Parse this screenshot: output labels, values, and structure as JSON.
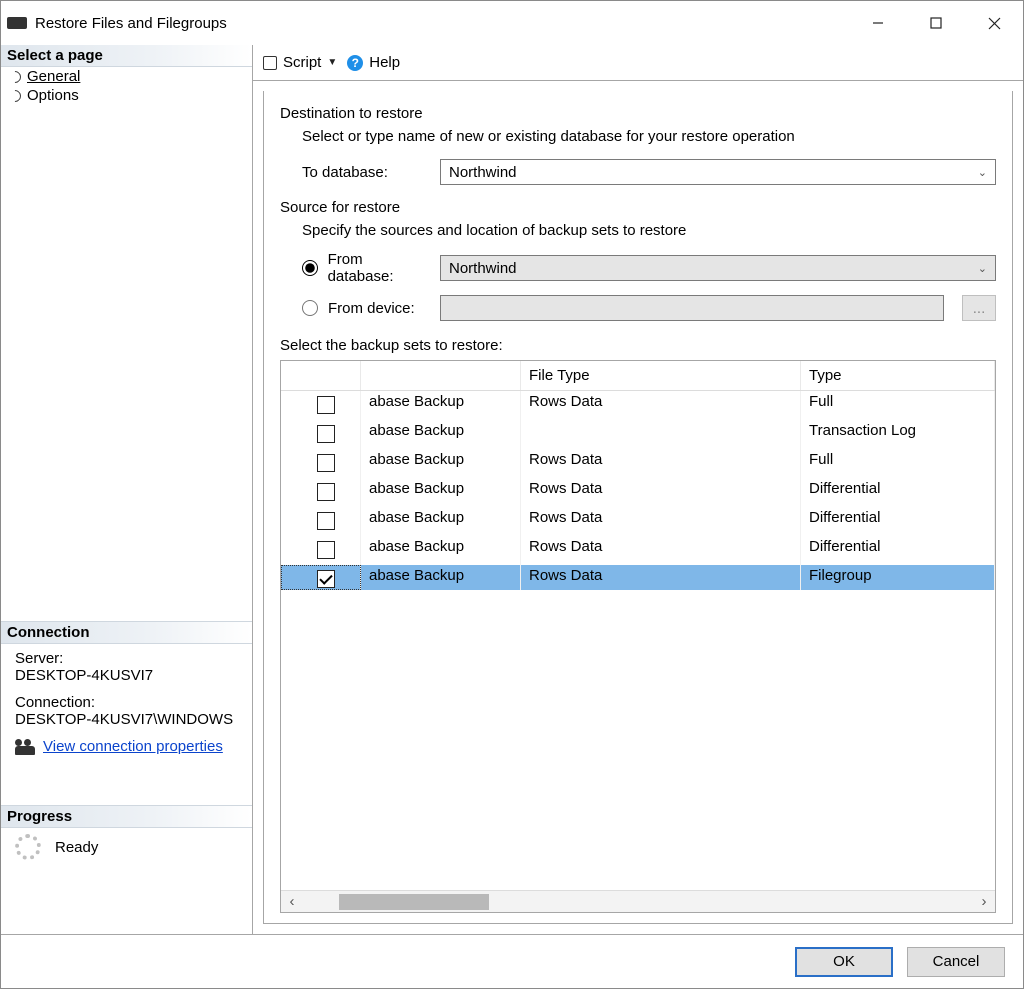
{
  "window": {
    "title": "Restore Files and Filegroups"
  },
  "sidebar": {
    "pages_header": "Select a page",
    "pages": [
      {
        "label": "General",
        "selected": true
      },
      {
        "label": "Options",
        "selected": false
      }
    ],
    "connection_header": "Connection",
    "server_label": "Server:",
    "server_value": "DESKTOP-4KUSVI7",
    "connection_label": "Connection:",
    "connection_value": "DESKTOP-4KUSVI7\\WINDOWS",
    "view_props_link": "View connection properties",
    "progress_header": "Progress",
    "progress_status": "Ready"
  },
  "toolbar": {
    "script": "Script",
    "help": "Help"
  },
  "content": {
    "dest_title": "Destination to restore",
    "dest_subtitle": "Select or type name of new or existing database for your restore operation",
    "to_db_label": "To database:",
    "to_db_value": "Northwind",
    "src_title": "Source for restore",
    "src_subtitle": "Specify the sources and location of backup sets to restore",
    "from_db_label": "From database:",
    "from_db_value": "Northwind",
    "from_device_label": "From device:",
    "browse_ellipsis": "...",
    "select_sets_label": "Select the backup sets to restore:",
    "columns": {
      "c0": "",
      "c1": "",
      "c2": "File Type",
      "c3": "Type"
    },
    "rows": [
      {
        "checked": false,
        "c1": "abase Backup",
        "c2": "Rows Data",
        "c3": "Full"
      },
      {
        "checked": false,
        "c1": "abase Backup",
        "c2": "",
        "c3": "Transaction Log"
      },
      {
        "checked": false,
        "c1": "abase Backup",
        "c2": "Rows Data",
        "c3": "Full"
      },
      {
        "checked": false,
        "c1": "abase Backup",
        "c2": "Rows Data",
        "c3": "Differential"
      },
      {
        "checked": false,
        "c1": "abase Backup",
        "c2": "Rows Data",
        "c3": "Differential"
      },
      {
        "checked": false,
        "c1": "abase Backup",
        "c2": "Rows Data",
        "c3": "Differential"
      },
      {
        "checked": true,
        "c1": "abase Backup",
        "c2": "Rows Data",
        "c3": "Filegroup",
        "selected": true
      }
    ]
  },
  "footer": {
    "ok": "OK",
    "cancel": "Cancel"
  }
}
